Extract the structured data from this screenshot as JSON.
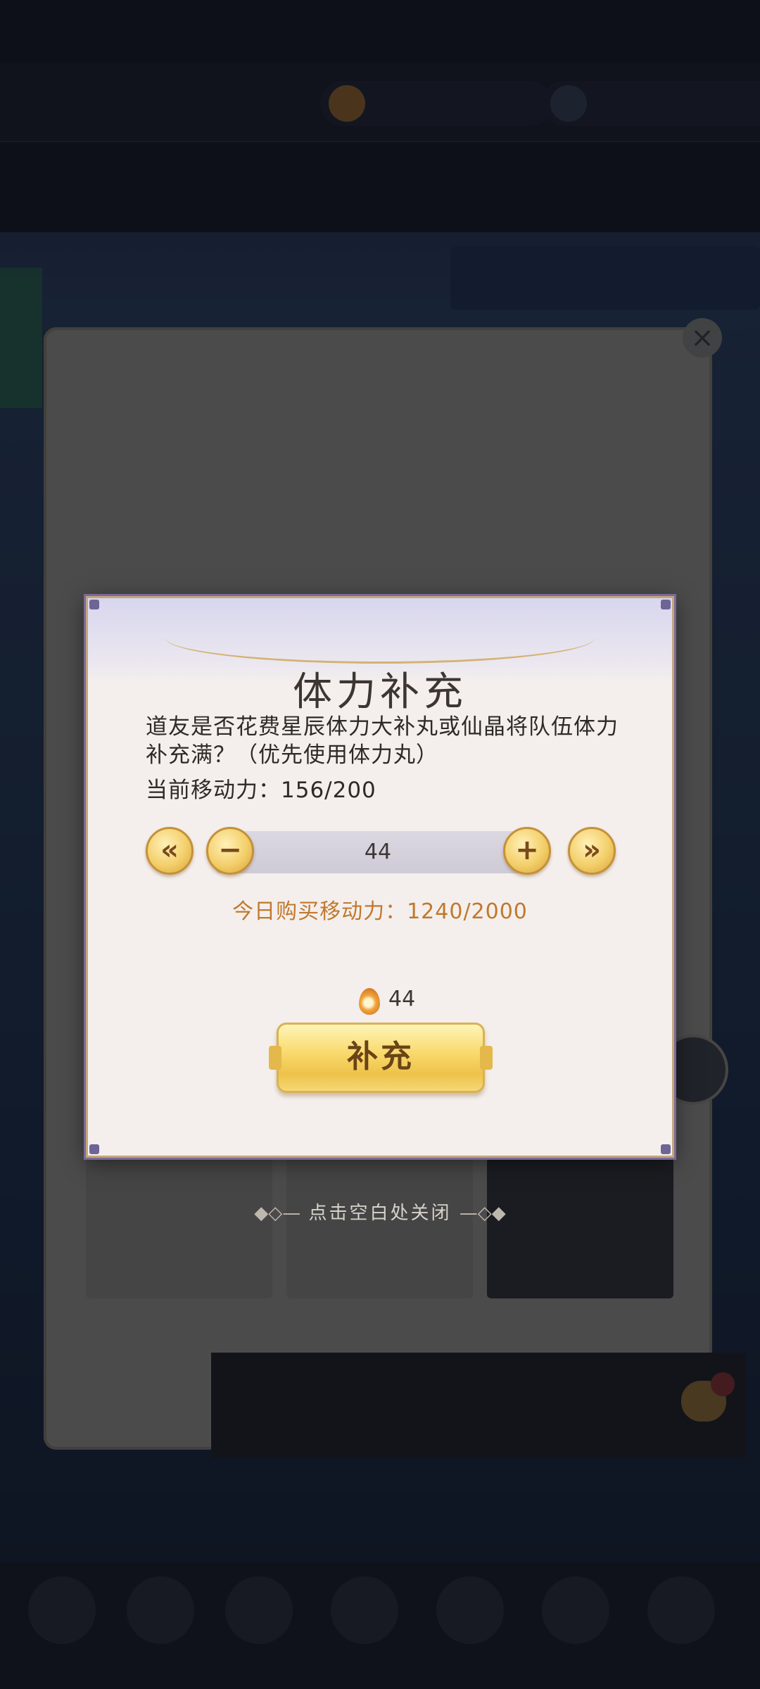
{
  "dialog": {
    "title": "体力补充",
    "description": "道友是否花费星辰体力大补丸或仙晶将队伍体力补充满？（优先使用体力丸）",
    "mobility_label": "当前移动力：156/200",
    "stepper": {
      "quantity": "44",
      "min_glyph": "«",
      "minus_glyph": "−",
      "plus_glyph": "+",
      "max_glyph": "»"
    },
    "daily_purchase": "今日购买移动力：1240/2000",
    "cost": {
      "amount": "44",
      "icon": "spirit-crystal-icon"
    },
    "supply_button": "补充"
  },
  "close_hint": "点击空白处关闭",
  "close_hint_left": "◆◇—",
  "close_hint_right": "—◇◆",
  "colors": {
    "dialog_bg": "#f4efec",
    "button_gold": "#f8d86a",
    "daily_text": "#c0782e",
    "dialog_border": "#c4a67a"
  }
}
